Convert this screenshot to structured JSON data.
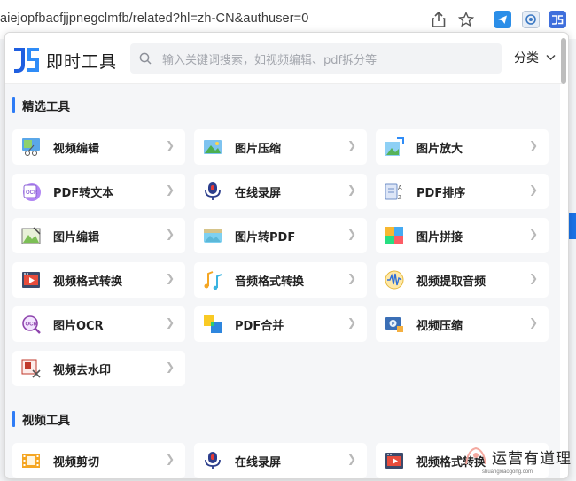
{
  "browser": {
    "url": "aiejopfbacfjjpnegclmfb/related?hl=zh-CN&authuser=0",
    "icons": [
      "share-icon",
      "star-icon",
      "telegram-extension-icon",
      "camera-extension-icon",
      "jishi-extension-icon"
    ]
  },
  "popup": {
    "logo_text": "即时工具",
    "search_placeholder": "输入关键词搜索，如视频编辑、pdf拆分等",
    "category_label": "分类"
  },
  "sections": [
    {
      "title": "精选工具",
      "tools": [
        {
          "label": "视频编辑",
          "icon": "video-edit-icon"
        },
        {
          "label": "图片压缩",
          "icon": "image-compress-icon"
        },
        {
          "label": "图片放大",
          "icon": "image-enlarge-icon"
        },
        {
          "label": "PDF转文本",
          "icon": "pdf-ocr-icon"
        },
        {
          "label": "在线录屏",
          "icon": "screen-record-icon"
        },
        {
          "label": "PDF排序",
          "icon": "pdf-sort-icon"
        },
        {
          "label": "图片编辑",
          "icon": "image-edit-icon"
        },
        {
          "label": "图片转PDF",
          "icon": "image-to-pdf-icon"
        },
        {
          "label": "图片拼接",
          "icon": "image-stitch-icon"
        },
        {
          "label": "视频格式转换",
          "icon": "video-convert-icon"
        },
        {
          "label": "音频格式转换",
          "icon": "audio-convert-icon"
        },
        {
          "label": "视频提取音频",
          "icon": "extract-audio-icon"
        },
        {
          "label": "图片OCR",
          "icon": "image-ocr-icon"
        },
        {
          "label": "PDF合并",
          "icon": "pdf-merge-icon"
        },
        {
          "label": "视频压缩",
          "icon": "video-compress-icon"
        },
        {
          "label": "视频去水印",
          "icon": "remove-watermark-icon"
        }
      ]
    },
    {
      "title": "视频工具",
      "tools": [
        {
          "label": "视频剪切",
          "icon": "video-cut-icon"
        },
        {
          "label": "在线录屏",
          "icon": "screen-record-icon"
        },
        {
          "label": "视频格式转换",
          "icon": "video-convert-icon"
        }
      ]
    }
  ],
  "watermark": {
    "text": "运营有道理",
    "sub": "shuangxiaogong.com"
  },
  "colors": {
    "accent": "#2e7cf6",
    "page_background": "#f5f6f8",
    "card_background": "#ffffff"
  }
}
